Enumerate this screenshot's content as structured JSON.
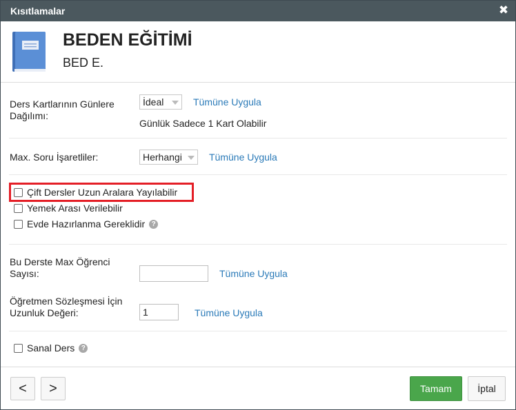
{
  "window": {
    "title": "Kısıtlamalar",
    "close_glyph": "✖"
  },
  "course": {
    "name": "BEDEN EĞİTİMİ",
    "short_name": "BED E.",
    "icon": "book-icon"
  },
  "distribution": {
    "label": "Ders Kartlarının Günlere Dağılımı:",
    "selected": "İdeal",
    "apply_all": "Tümüne Uygula",
    "note": "Günlük Sadece 1 Kart Olabilir"
  },
  "max_marks": {
    "label": "Max. Soru İşaretliler:",
    "selected": "Herhangi",
    "apply_all": "Tümüne Uygula"
  },
  "options": {
    "double_lessons": {
      "label": "Çift Dersler Uzun Aralara Yayılabilir",
      "checked": false
    },
    "lunch_break": {
      "label": "Yemek Arası Verilebilir",
      "checked": false
    },
    "home_prep": {
      "label": "Evde Hazırlanma Gereklidir",
      "checked": false,
      "help": "?"
    }
  },
  "max_students": {
    "label": "Bu Derste Max Öğrenci Sayısı:",
    "value": "",
    "apply_all": "Tümüne Uygula"
  },
  "contract_length": {
    "label": "Öğretmen Sözleşmesi İçin Uzunluk Değeri:",
    "value": "1",
    "apply_all": "Tümüne Uygula"
  },
  "virtual": {
    "label": "Sanal Ders",
    "checked": false,
    "help": "?"
  },
  "footer": {
    "prev": "<",
    "next": ">",
    "ok": "Tamam",
    "cancel": "İptal"
  },
  "colors": {
    "titlebar": "#4b585e",
    "link": "#2a7ab8",
    "ok_button": "#4aa64b",
    "highlight": "#e41e26",
    "book_icon": "#5b8fd6"
  }
}
